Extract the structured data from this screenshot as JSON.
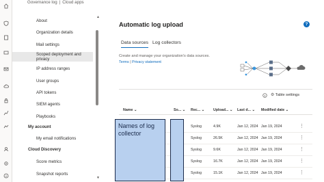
{
  "breadcrumb": {
    "parent": "Governance log",
    "separator": "|",
    "current": "Cloud apps"
  },
  "rail": {
    "icons": [
      "home-icon",
      "shield-icon",
      "document-icon",
      "devices-icon",
      "chart-icon",
      "mail-icon",
      "cloud-icon",
      "lock-icon",
      "people-icon",
      "graph-icon",
      "trend-icon",
      "settings-icon",
      "info-icon"
    ]
  },
  "nav": {
    "items": [
      {
        "label": "About",
        "type": "sub"
      },
      {
        "label": "Organization details",
        "type": "sub"
      },
      {
        "label": "Mail settings",
        "type": "sub"
      },
      {
        "label": "Scoped deployment and privacy",
        "type": "sub"
      },
      {
        "label": "IP address ranges",
        "type": "sub"
      },
      {
        "label": "User groups",
        "type": "sub"
      },
      {
        "label": "API tokens",
        "type": "sub"
      },
      {
        "label": "SIEM agents",
        "type": "sub"
      },
      {
        "label": "Playbooks",
        "type": "sub"
      },
      {
        "label": "My account",
        "type": "section"
      },
      {
        "label": "My email notifications",
        "type": "sub"
      },
      {
        "label": "Cloud Discovery",
        "type": "section"
      },
      {
        "label": "Score metrics",
        "type": "sub"
      },
      {
        "label": "Snapshot reports",
        "type": "sub"
      }
    ]
  },
  "page": {
    "title": "Automatic log upload",
    "help": "?",
    "tabs": [
      {
        "label": "Data sources",
        "active": true
      },
      {
        "label": "Log collectors",
        "active": false
      }
    ],
    "description": "Create and manage your organization's data sources.",
    "terms_link": "Terms",
    "privacy_link": "Privacy statement"
  },
  "toolbar": {
    "table_settings_label": "Table settings"
  },
  "table": {
    "columns": [
      "Name",
      "So...",
      "Rec...",
      "Upload...",
      "Last d...",
      "Modified date"
    ],
    "rows": [
      {
        "receiver": "Syslog",
        "upload": "4.9K",
        "last": "Jan 12, 2024",
        "modified": "Jan 19, 2024"
      },
      {
        "receiver": "Syslog",
        "upload": "26.5K",
        "last": "Jan 12, 2024",
        "modified": "Jan 19, 2024"
      },
      {
        "receiver": "Syslog",
        "upload": "9.6K",
        "last": "Jan 12, 2024",
        "modified": "Jan 19, 2024"
      },
      {
        "receiver": "Syslog",
        "upload": "16.7K",
        "last": "Jan 12, 2024",
        "modified": "Jan 19, 2024"
      },
      {
        "receiver": "Syslog",
        "upload": "15.1K",
        "last": "Jan 12, 2024",
        "modified": "Jan 19, 2024"
      }
    ],
    "redaction_label": "Names of log collector"
  },
  "colors": {
    "accent": "#0f6cbd",
    "overlay_fill": "#b8d0ef",
    "overlay_border": "#1a2a4a"
  }
}
